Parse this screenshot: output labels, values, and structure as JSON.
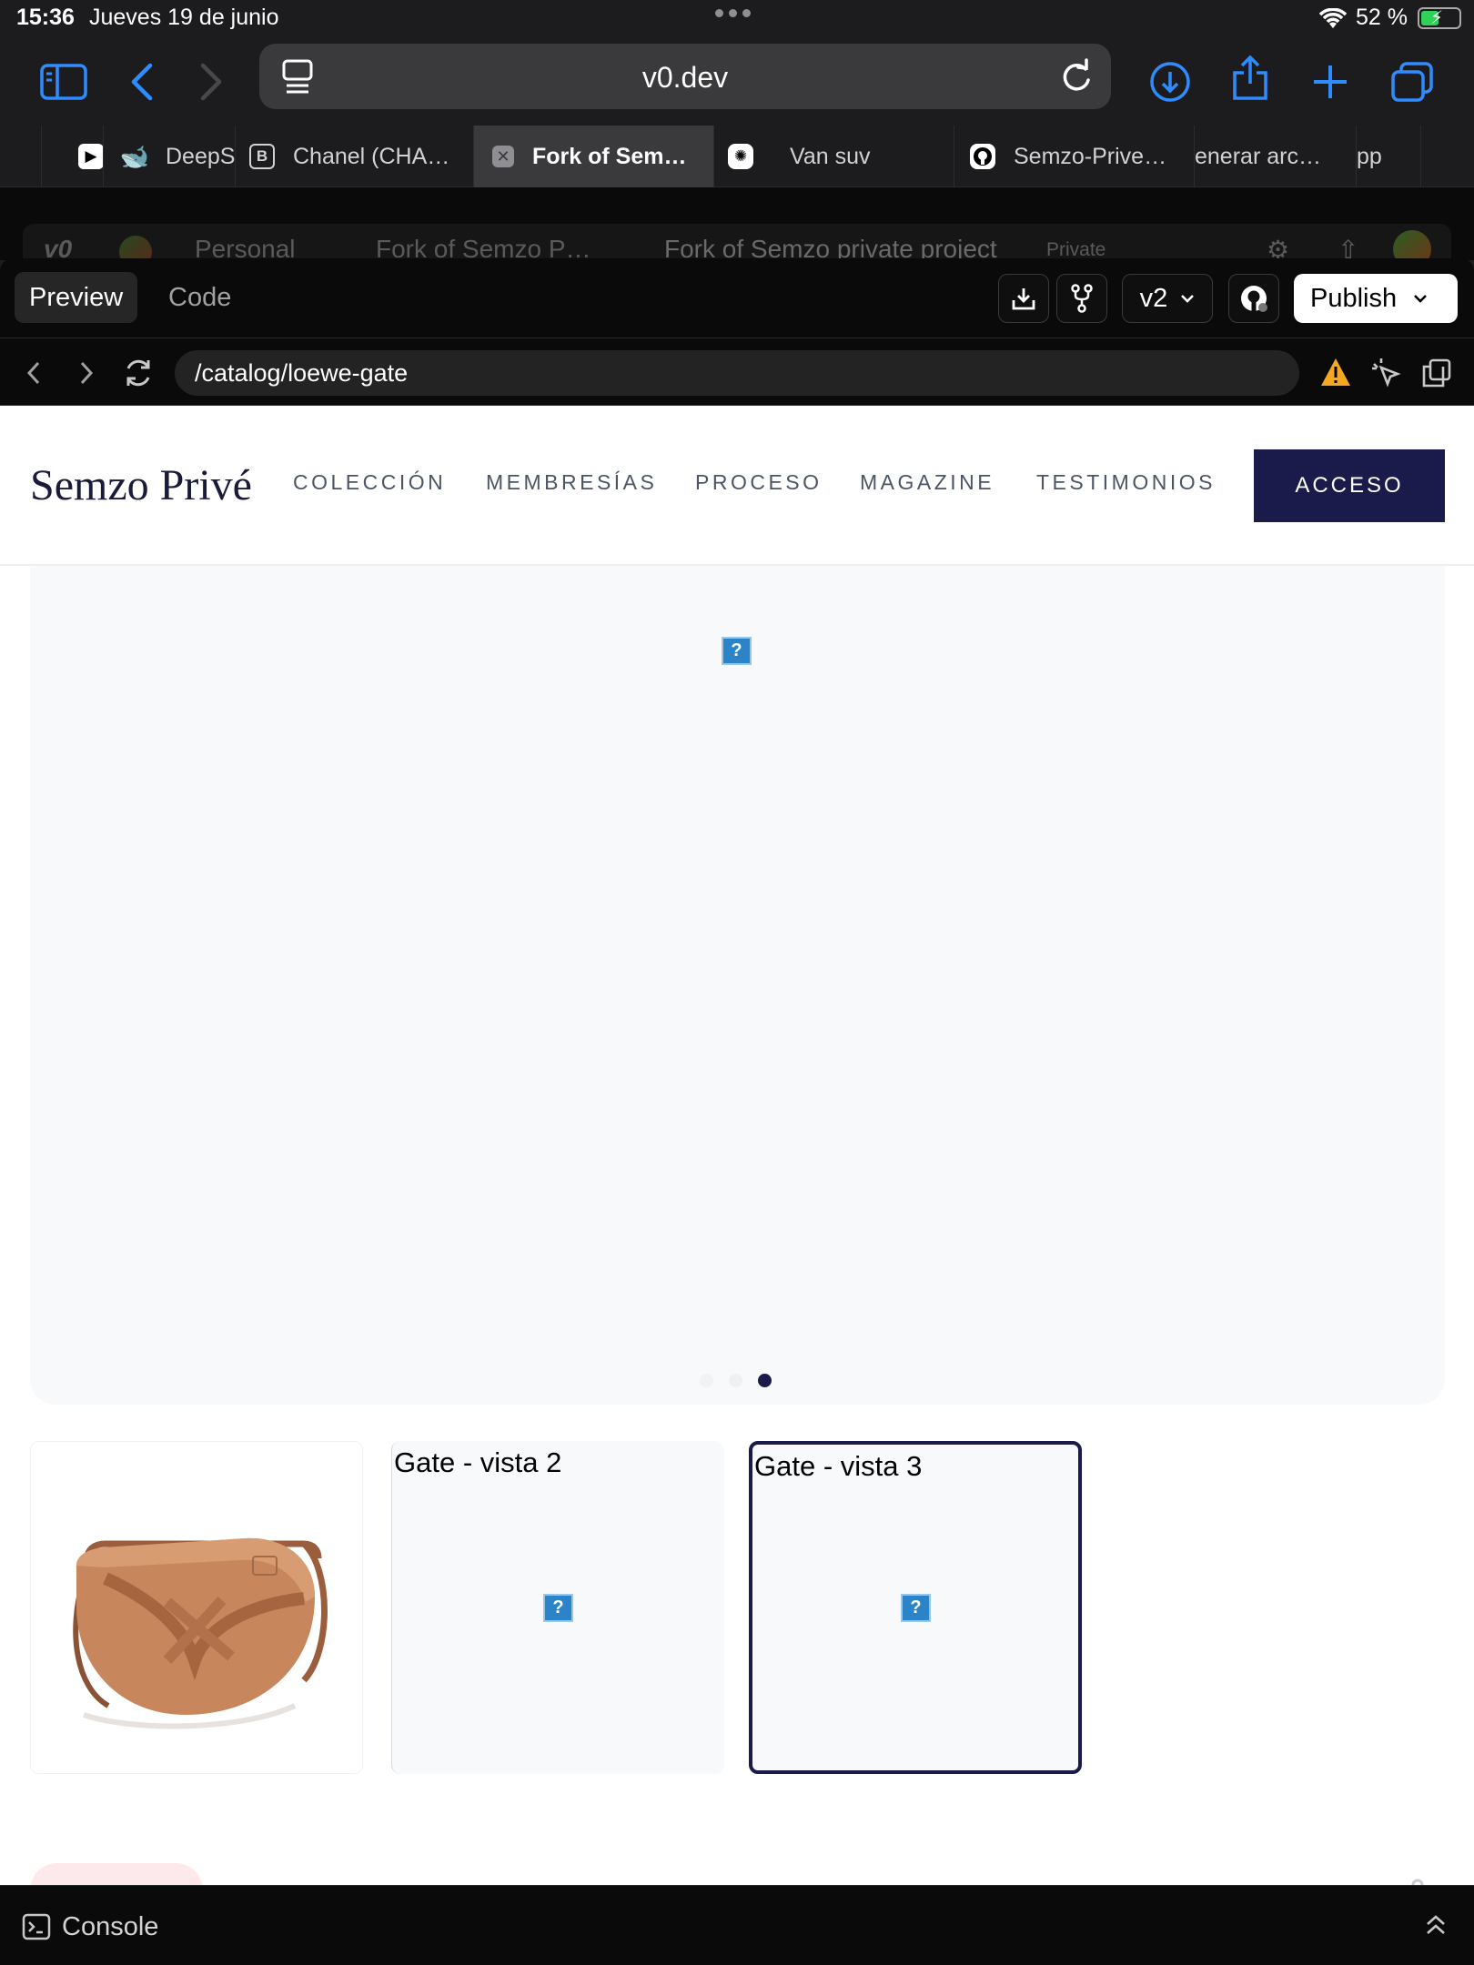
{
  "status_bar": {
    "time": "15:36",
    "date": "Jueves 19 de junio",
    "battery": "52 %",
    "battery_level": 0.52
  },
  "safari": {
    "url": "v0.dev",
    "icons": [
      "sidebar-icon",
      "back-icon",
      "forward-icon",
      "page-menu-icon",
      "reload-icon",
      "download-icon",
      "share-icon",
      "new-tab-icon",
      "tabs-overview-icon"
    ]
  },
  "tabs": [
    {
      "label": "",
      "icon": "play-icon"
    },
    {
      "label": "DeepS",
      "icon": "whale-icon"
    },
    {
      "label": "Chanel (CHA…",
      "icon": "b-icon"
    },
    {
      "label": "Fork of Sem…",
      "icon": "close-icon",
      "active": true
    },
    {
      "label": "Van suv",
      "icon": "openai-icon"
    },
    {
      "label": "Semzo-Prive…",
      "icon": "github-icon"
    },
    {
      "label": "enerar arc…",
      "icon": ""
    },
    {
      "label": "pp",
      "icon": ""
    }
  ],
  "v0": {
    "team": "Personal",
    "project": "Fork of Semzo P…",
    "chat_title": "Fork of Semzo private project",
    "visibility": "Private",
    "preview_tab": "Preview",
    "code_tab": "Code",
    "version": "v2",
    "publish": "Publish",
    "path": "/catalog/loewe-gate",
    "console": "Console"
  },
  "site": {
    "brand": "Semzo Privé",
    "nav": [
      "COLECCIÓN",
      "MEMBRESÍAS",
      "PROCESO",
      "MAGAZINE",
      "TESTIMONIOS"
    ],
    "cta": "ACCESO",
    "broken_image_glyph": "?",
    "carousel_active_index": 2,
    "carousel_count": 3,
    "thumbnails": [
      {
        "caption": "",
        "image": "tan-leather-saddle-bag"
      },
      {
        "caption": "Gate - vista 2"
      },
      {
        "caption": "Gate - vista 3",
        "selected": true
      }
    ]
  },
  "colors": {
    "safari_accent": "#2f8cff",
    "brand_navy": "#1b1b4b",
    "warning": "#f5a623"
  }
}
